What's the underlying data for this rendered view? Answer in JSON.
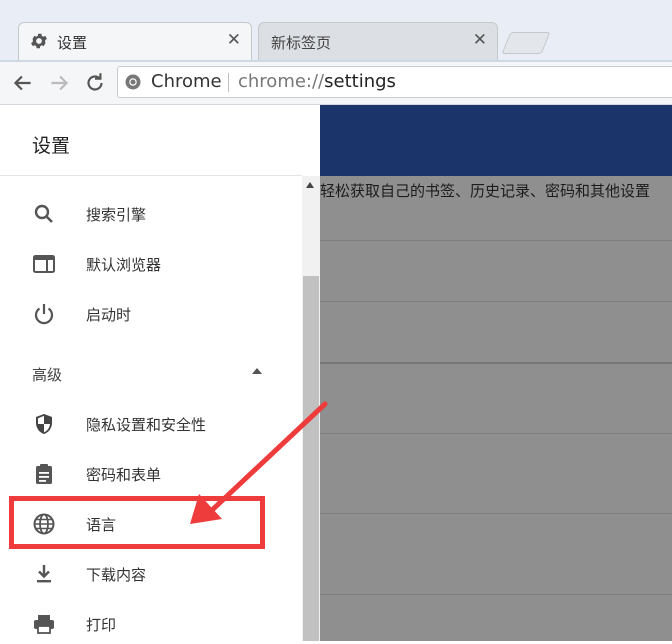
{
  "tabs": [
    {
      "title": "设置",
      "icon": "gear-icon",
      "active": true
    },
    {
      "title": "新标签页",
      "icon": "",
      "active": false
    }
  ],
  "toolbar": {
    "omnibox_chip": "Chrome",
    "url_scheme": "chrome://",
    "url_path": "settings"
  },
  "sidebar": {
    "title": "设置",
    "items": [
      {
        "label": "搜索引擎",
        "icon": "search-icon"
      },
      {
        "label": "默认浏览器",
        "icon": "browser-window-icon"
      },
      {
        "label": "启动时",
        "icon": "power-icon"
      }
    ],
    "advanced_label": "高级",
    "advanced_items": [
      {
        "label": "隐私设置和安全性",
        "icon": "shield-icon"
      },
      {
        "label": "密码和表单",
        "icon": "clipboard-icon"
      },
      {
        "label": "语言",
        "icon": "globe-icon"
      },
      {
        "label": "下载内容",
        "icon": "download-icon"
      },
      {
        "label": "打印",
        "icon": "printer-icon"
      }
    ]
  },
  "main": {
    "sync_text": "轻松获取自己的书签、历史记录、密码和其他设置"
  },
  "colors": {
    "annotation": "#ee3b3b",
    "header_bar": "#1b346a",
    "overlay": "#8f8f8f"
  }
}
